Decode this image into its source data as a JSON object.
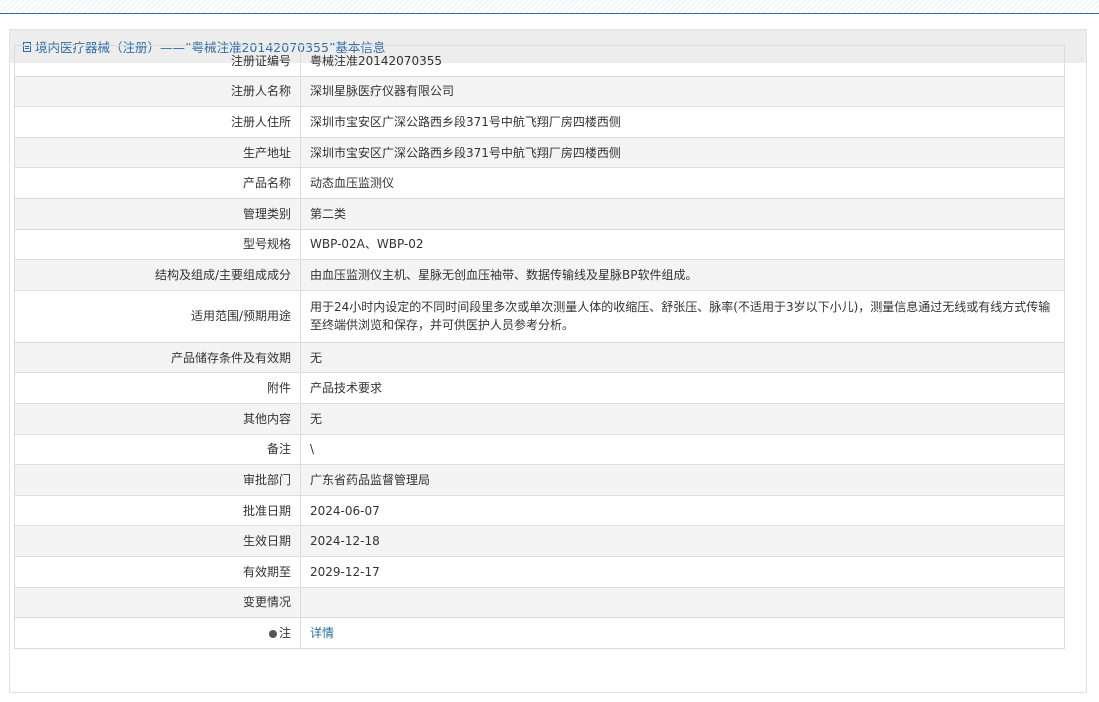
{
  "header": {
    "title": "境内医疗器械（注册）——“粤械注准20142070355”基本信息"
  },
  "rows": [
    {
      "label": "注册证编号",
      "value": "粤械注准20142070355"
    },
    {
      "label": "注册人名称",
      "value": "深圳星脉医疗仪器有限公司"
    },
    {
      "label": "注册人住所",
      "value": "深圳市宝安区广深公路西乡段371号中航飞翔厂房四楼西侧"
    },
    {
      "label": "生产地址",
      "value": "深圳市宝安区广深公路西乡段371号中航飞翔厂房四楼西侧"
    },
    {
      "label": "产品名称",
      "value": "动态血压监测仪"
    },
    {
      "label": "管理类别",
      "value": "第二类"
    },
    {
      "label": "型号规格",
      "value": "WBP-02A、WBP-02"
    },
    {
      "label": "结构及组成/主要组成成分",
      "value": "由血压监测仪主机、星脉无创血压袖带、数据传输线及星脉BP软件组成。"
    },
    {
      "label": "适用范围/预期用途",
      "value": "用于24小时内设定的不同时间段里多次或单次测量人体的收缩压、舒张压、脉率(不适用于3岁以下小儿)，测量信息通过无线或有线方式传输至终端供浏览和保存，并可供医护人员参考分析。"
    },
    {
      "label": "产品储存条件及有效期",
      "value": "无"
    },
    {
      "label": "附件",
      "value": "产品技术要求"
    },
    {
      "label": "其他内容",
      "value": "无"
    },
    {
      "label": "备注",
      "value": "\\"
    },
    {
      "label": "审批部门",
      "value": "广东省药品监督管理局"
    },
    {
      "label": "批准日期",
      "value": "2024-06-07"
    },
    {
      "label": "生效日期",
      "value": "2024-12-18"
    },
    {
      "label": "有效期至",
      "value": "2029-12-17"
    },
    {
      "label": "变更情况",
      "value": ""
    }
  ],
  "note_row": {
    "label": "注",
    "icon": "bulb-icon",
    "link_text": "详情"
  }
}
